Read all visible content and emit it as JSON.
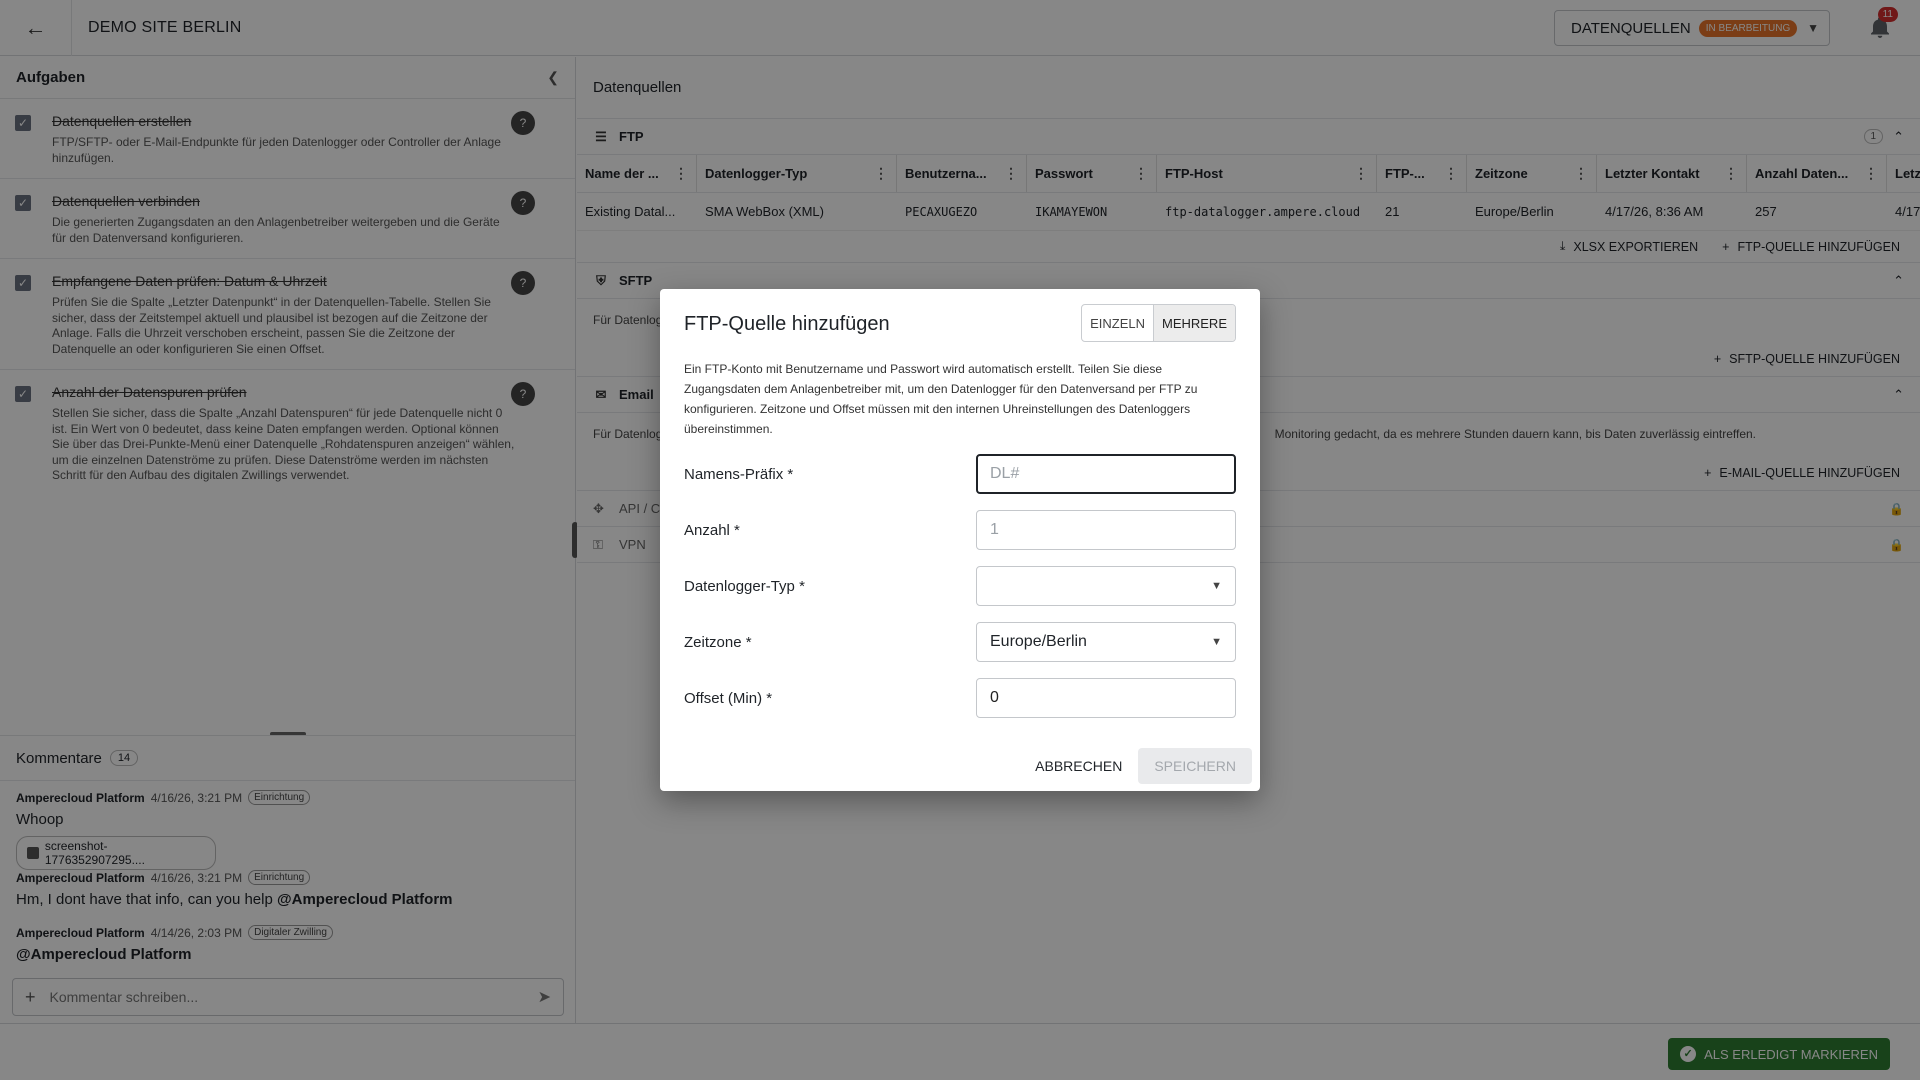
{
  "header": {
    "site_title": "DEMO SITE BERLIN",
    "datasource_select": "DATENQUELLEN",
    "status_badge": "IN BEARBEITUNG",
    "notification_count": "11"
  },
  "tasks": {
    "title": "Aufgaben",
    "items": [
      {
        "title": "Datenquellen erstellen",
        "desc": "FTP/SFTP- oder E-Mail-Endpunkte für jeden Datenlogger oder Controller der Anlage hinzufügen."
      },
      {
        "title": "Datenquellen verbinden",
        "desc": "Die generierten Zugangsdaten an den Anlagenbetreiber weitergeben und die Geräte für den Datenversand konfigurieren."
      },
      {
        "title": "Empfangene Daten prüfen: Datum & Uhrzeit",
        "desc": "Prüfen Sie die Spalte „Letzter Datenpunkt“ in der Datenquellen-Tabelle. Stellen Sie sicher, dass der Zeitstempel aktuell und plausibel ist bezogen auf die Zeitzone der Anlage. Falls die Uhrzeit verschoben erscheint, passen Sie die Zeitzone der Datenquelle an oder konfigurieren Sie einen Offset."
      },
      {
        "title": "Anzahl der Datenspuren prüfen",
        "desc": "Stellen Sie sicher, dass die Spalte „Anzahl Datenspuren“ für jede Datenquelle nicht 0 ist. Ein Wert von 0 bedeutet, dass keine Daten empfangen werden. Optional können Sie über das Drei-Punkte-Menü einer Datenquelle „Rohdatenspuren anzeigen“ wählen, um die einzelnen Datenströme zu prüfen. Diese Datenströme werden im nächsten Schritt für den Aufbau des digitalen Zwillings verwendet."
      }
    ]
  },
  "comments": {
    "title": "Kommentare",
    "count": "14",
    "items": [
      {
        "author": "Amperecloud Platform",
        "date": "4/16/26, 3:21 PM",
        "tag": "Einrichtung",
        "body": "Whoop",
        "attachment": "screenshot-1776352907295...."
      },
      {
        "author": "Amperecloud Platform",
        "date": "4/16/26, 3:21 PM",
        "tag": "Einrichtung",
        "body": "Hm, I dont have that info, can you help ",
        "mention": "@Amperecloud Platform"
      },
      {
        "author": "Amperecloud Platform",
        "date": "4/14/26, 2:03 PM",
        "tag": "Digitaler Zwilling",
        "mention": "@Amperecloud Platform"
      }
    ],
    "input_placeholder": "Kommentar schreiben..."
  },
  "datasources": {
    "title": "Datenquellen",
    "ftp": {
      "label": "FTP",
      "count": "1",
      "columns": [
        "Name der ...",
        "Datenlogger-Typ",
        "Benutzerna...",
        "Passwort",
        "FTP-Host",
        "FTP-...",
        "Zeitzone",
        "Letzter Kontakt",
        "Anzahl Daten...",
        "Letz"
      ],
      "rows": [
        [
          "Existing Datal...",
          "SMA WebBox (XML)",
          "PECAXUGEZO",
          "IKAMAYEWON",
          "ftp-datalogger.ampere.cloud",
          "21",
          "Europe/Berlin",
          "4/17/26, 8:36 AM",
          "257",
          "4/17"
        ]
      ],
      "export_label": "XLSX EXPORTIEREN",
      "add_label": "FTP-QUELLE HINZUFÜGEN"
    },
    "sftp": {
      "label": "SFTP",
      "desc": "Für Datenlog",
      "add_label": "SFTP-QUELLE HINZUFÜGEN"
    },
    "email": {
      "label": "Email",
      "desc_start": "Für Datenlog",
      "desc_end": "Monitoring gedacht, da es mehrere Stunden dauern kann, bis Daten zuverlässig eintreffen.",
      "add_label": "E-MAIL-QUELLE HINZUFÜGEN"
    },
    "api": {
      "label": "API / C"
    },
    "vpn": {
      "label": "VPN"
    }
  },
  "footer": {
    "done_label": "ALS ERLEDIGT MARKIEREN"
  },
  "modal": {
    "title": "FTP-Quelle hinzufügen",
    "toggle_single": "EINZELN",
    "toggle_multi": "MEHRERE",
    "intro": "Ein FTP-Konto mit Benutzername und Passwort wird automatisch erstellt. Teilen Sie diese Zugangsdaten dem Anlagenbetreiber mit, um den Datenlogger für den Datenversand per FTP zu konfigurieren. Zeitzone und Offset müssen mit den internen Uhreinstellungen des Datenloggers übereinstimmen.",
    "fields": {
      "prefix_label": "Namens-Präfix *",
      "prefix_placeholder": "DL#",
      "count_label": "Anzahl *",
      "count_placeholder": "1",
      "type_label": "Datenlogger-Typ *",
      "type_value": "",
      "tz_label": "Zeitzone *",
      "tz_value": "Europe/Berlin",
      "offset_label": "Offset (Min) *",
      "offset_value": "0"
    },
    "cancel_label": "ABBRECHEN",
    "save_label": "SPEICHERN"
  },
  "colors": {
    "badge_orange": "#e8742a",
    "done_green": "#2e7d32",
    "notification_red": "#d32f2f"
  }
}
